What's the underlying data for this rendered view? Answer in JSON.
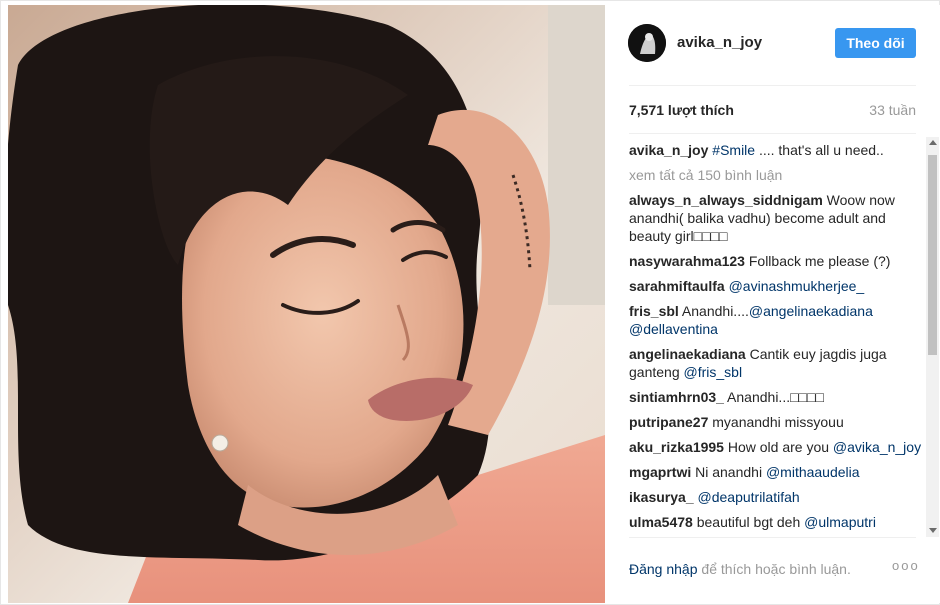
{
  "post": {
    "username": "avika_n_joy",
    "follow_label": "Theo dõi",
    "likes": "7,571 lượt thích",
    "time": "33 tuần"
  },
  "caption": {
    "username": "avika_n_joy",
    "tag": "#Smile",
    "text": " .... that's all u need.."
  },
  "view_all": "xem tất cả 150 bình luận",
  "comments": [
    {
      "user": "always_n_always_siddnigam",
      "parts": [
        {
          "text": " Woow now anandhi( balika vadhu) become adult and beauty girl□□□□"
        }
      ]
    },
    {
      "user": "nasywarahma123",
      "parts": [
        {
          "text": " Follback me please (?)"
        }
      ]
    },
    {
      "user": "sarahmiftaulfa",
      "parts": [
        {
          "text": " "
        },
        {
          "tag": "@avinashmukherjee_"
        }
      ]
    },
    {
      "user": "fris_sbl",
      "parts": [
        {
          "text": " Anandhi...."
        },
        {
          "tag": "@angelinaekadiana"
        },
        {
          "text": " "
        },
        {
          "tag": "@dellaventina"
        }
      ]
    },
    {
      "user": "angelinaekadiana",
      "parts": [
        {
          "text": " Cantik euy jagdis juga ganteng "
        },
        {
          "tag": "@fris_sbl"
        }
      ]
    },
    {
      "user": "sintiamhrn03_",
      "parts": [
        {
          "text": " Anandhi...□□□□"
        }
      ]
    },
    {
      "user": "putripane27",
      "parts": [
        {
          "text": " myanandhi missyouu"
        }
      ]
    },
    {
      "user": "aku_rizka1995",
      "parts": [
        {
          "text": " How old are you "
        },
        {
          "tag": "@avika_n_joy"
        }
      ]
    },
    {
      "user": "mgaprtwi",
      "parts": [
        {
          "text": " Ni anandhi "
        },
        {
          "tag": "@mithaaudelia"
        }
      ]
    },
    {
      "user": "ikasurya_",
      "parts": [
        {
          "text": " "
        },
        {
          "tag": "@deaputrilatifah"
        }
      ]
    },
    {
      "user": "ulma5478",
      "parts": [
        {
          "text": " beautiful bgt deh "
        },
        {
          "tag": "@ulmaputri"
        }
      ]
    }
  ],
  "footer": {
    "login": "Đăng nhập",
    "rest": " để thích hoặc bình luận.",
    "more": "ooo"
  },
  "colors": {
    "accent": "#3897f0",
    "link": "#003569",
    "muted": "#999999"
  }
}
